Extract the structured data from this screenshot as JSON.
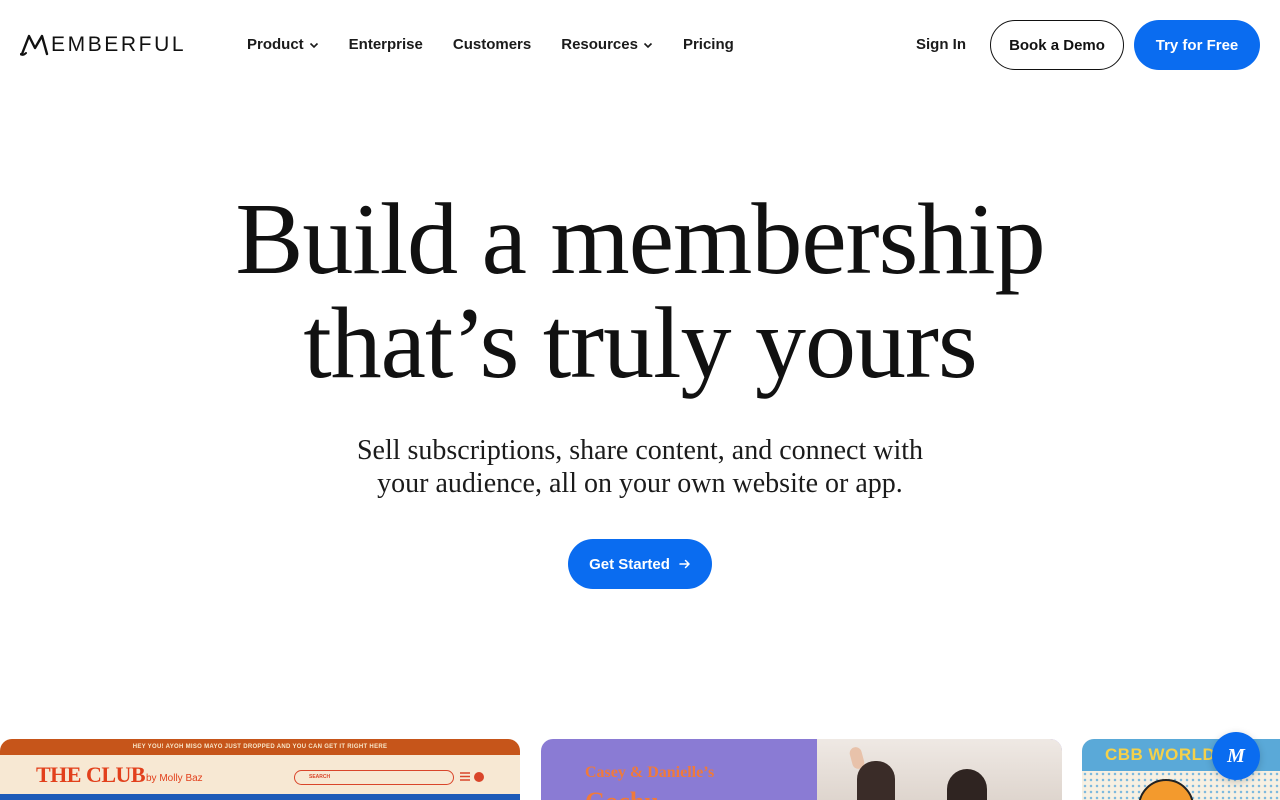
{
  "header": {
    "logo_text": "EMBERFUL",
    "logo_icon": "memberful-m-logo",
    "nav": [
      {
        "label": "Product",
        "has_dropdown": true
      },
      {
        "label": "Enterprise",
        "has_dropdown": false
      },
      {
        "label": "Customers",
        "has_dropdown": false
      },
      {
        "label": "Resources",
        "has_dropdown": true
      },
      {
        "label": "Pricing",
        "has_dropdown": false
      }
    ],
    "sign_in": "Sign In",
    "book_demo": "Book a Demo",
    "try_free": "Try for Free"
  },
  "hero": {
    "title_line1": "Build a membership",
    "title_line2": "that’s truly yours",
    "subtitle_line1": "Sell subscriptions, share content, and connect with",
    "subtitle_line2": "your audience, all on your own website or app.",
    "cta": "Get Started"
  },
  "showcase": {
    "card1": {
      "banner": "HEY YOU! AYOH MISO MAYO JUST DROPPED AND YOU CAN GET IT RIGHT HERE",
      "title": "THE CLUB",
      "byline": "by Molly Baz",
      "search_placeholder": "SEARCH"
    },
    "card2": {
      "title_line1": "Casey & Danielle’s",
      "title_line2": "Gochu..."
    },
    "card3": {
      "title": "CBB WORLD"
    }
  },
  "chat": {
    "icon": "memberful-chat-icon",
    "glyph": "M"
  },
  "colors": {
    "accent": "#0a6cf0",
    "text": "#111111",
    "background": "#ffffff"
  }
}
